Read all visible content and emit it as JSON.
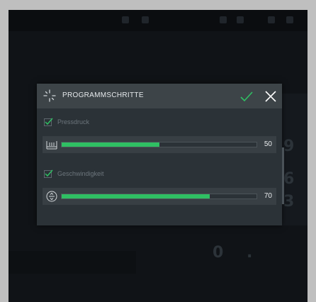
{
  "dialog": {
    "title": "PROGRAMMSCHRITTE",
    "params": [
      {
        "label": "Pressdruck",
        "checked": true,
        "value": "50",
        "fraction": 0.5
      },
      {
        "label": "Geschwindigkeit",
        "checked": true,
        "value": "70",
        "fraction": 0.76
      }
    ]
  },
  "colors": {
    "accent": "#2fbf63",
    "header": "#3d4448",
    "dialog_bg": "#2b3237"
  },
  "icons": {
    "header": "spinner-icon",
    "confirm": "checkmark-icon",
    "close": "close-icon",
    "param1": "pressure-icon",
    "param2": "speed-icon"
  }
}
